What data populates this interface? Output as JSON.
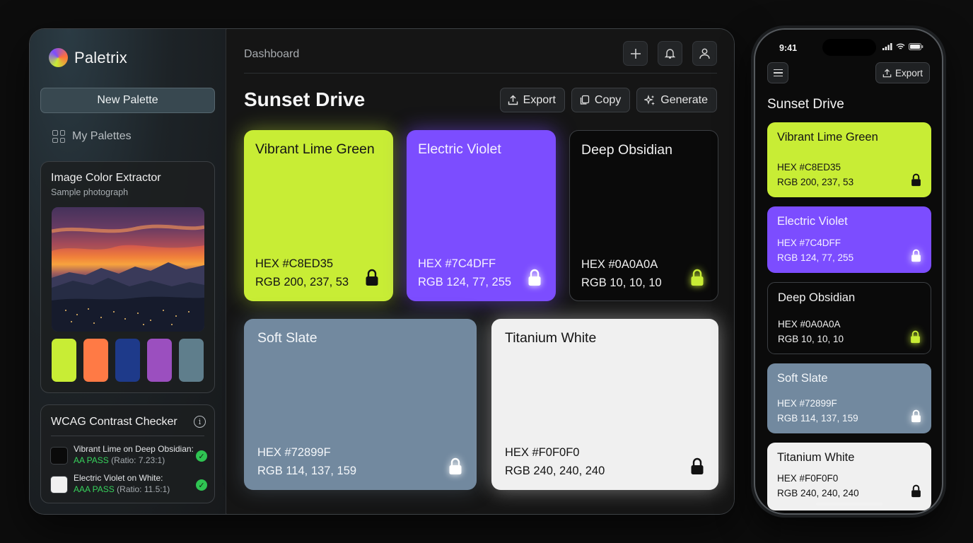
{
  "app": {
    "name": "Paletrix",
    "new_palette_label": "New Palette",
    "my_palettes_label": "My Palettes"
  },
  "extractor": {
    "title": "Image Color Extractor",
    "subtitle": "Sample photograph",
    "swatches": [
      "#C8ED35",
      "#FF7A45",
      "#1E3A8A",
      "#9B4FBF",
      "#5F7E8C"
    ]
  },
  "wcag": {
    "title": "WCAG Contrast Checker",
    "checks": [
      {
        "pair": "Vibrant Lime on Deep Obsidian:",
        "result": "AA PASS",
        "ratio": "(Ratio: 7.23:1)",
        "swatch": "#0A0A0A"
      },
      {
        "pair": "Electric Violet on White:",
        "result": "AAA PASS",
        "ratio": "(Ratio: 11.5:1)",
        "swatch": "#F0F0F0"
      }
    ]
  },
  "header": {
    "breadcrumb": "Dashboard",
    "palette_title": "Sunset Drive",
    "export_label": "Export",
    "copy_label": "Copy",
    "generate_label": "Generate"
  },
  "colors": [
    {
      "name": "Vibrant Lime Green",
      "hex": "HEX #C8ED35",
      "rgb": "RGB 200, 237, 53",
      "bg": "#C8ED35",
      "text": "#141414",
      "lock": "#111111",
      "glow": "rgba(200,237,53,0.45)"
    },
    {
      "name": "Electric Violet",
      "hex": "HEX #7C4DFF",
      "rgb": "RGB 124, 77, 255",
      "bg": "#7C4DFF",
      "text": "#F4F0FF",
      "lock": "#FFFFFF",
      "glow": "rgba(124,77,255,0.55)"
    },
    {
      "name": "Deep Obsidian",
      "hex": "HEX #0A0A0A",
      "rgb": "RGB 10, 10, 10",
      "bg": "#0A0A0A",
      "text": "#EFEFEF",
      "lock": "#C8ED35",
      "glow": "rgba(0,0,0,0)"
    },
    {
      "name": "Soft Slate",
      "hex": "HEX #72899F",
      "rgb": "RGB 114, 137, 159",
      "bg": "#72899F",
      "text": "#F4F7FA",
      "lock": "#FFFFFF",
      "glow": "rgba(114,137,159,0.35)"
    },
    {
      "name": "Titanium White",
      "hex": "HEX #F0F0F0",
      "rgb": "RGB 240, 240, 240",
      "bg": "#F0F0F0",
      "text": "#141414",
      "lock": "#111111",
      "glow": "rgba(240,240,240,0.45)"
    }
  ],
  "phone": {
    "time": "9:41",
    "export_label": "Export",
    "palette_title": "Sunset Drive"
  }
}
